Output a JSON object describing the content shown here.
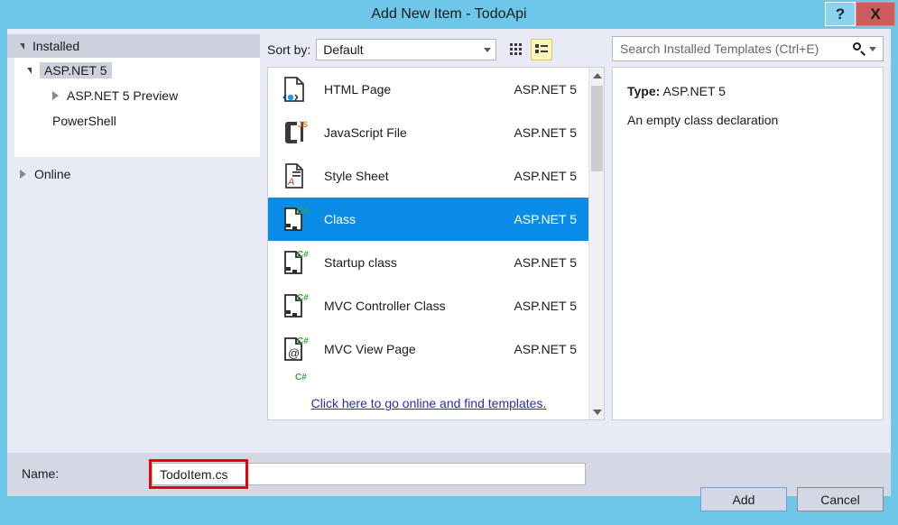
{
  "window": {
    "title": "Add New Item - TodoApi",
    "help_label": "?",
    "close_label": "X"
  },
  "sidebar": {
    "installed_label": "Installed",
    "tree": [
      {
        "label": "ASP.NET 5",
        "selected": true,
        "expanded": true
      },
      {
        "label": "ASP.NET 5 Preview",
        "selected": false,
        "expanded": false
      },
      {
        "label": "PowerShell",
        "selected": false,
        "expanded": null
      }
    ],
    "online_label": "Online"
  },
  "toolbar": {
    "sort_by_label": "Sort by:",
    "sort_value": "Default",
    "grid_view_title": "Medium Icons",
    "list_view_title": "List"
  },
  "search": {
    "placeholder": "Search Installed Templates (Ctrl+E)",
    "value": ""
  },
  "templates": {
    "items": [
      {
        "name": "HTML Page",
        "tag": "ASP.NET 5",
        "icon": "html-page-icon",
        "selected": false
      },
      {
        "name": "JavaScript File",
        "tag": "ASP.NET 5",
        "icon": "javascript-file-icon",
        "selected": false
      },
      {
        "name": "Style Sheet",
        "tag": "ASP.NET 5",
        "icon": "style-sheet-icon",
        "selected": false
      },
      {
        "name": "Class",
        "tag": "ASP.NET 5",
        "icon": "csharp-class-icon",
        "selected": true
      },
      {
        "name": "Startup class",
        "tag": "ASP.NET 5",
        "icon": "csharp-class-icon",
        "selected": false
      },
      {
        "name": "MVC Controller Class",
        "tag": "ASP.NET 5",
        "icon": "csharp-class-icon",
        "selected": false
      },
      {
        "name": "MVC View Page",
        "tag": "ASP.NET 5",
        "icon": "mvc-view-page-icon",
        "selected": false
      }
    ],
    "online_link_label": "Click here to go online and find templates."
  },
  "details": {
    "type_label": "Type:",
    "type_value": "ASP.NET 5",
    "description": "An empty class declaration"
  },
  "name_field": {
    "label": "Name:",
    "value": "TodoItem.cs"
  },
  "footer": {
    "add_label": "Add",
    "cancel_label": "Cancel"
  },
  "colors": {
    "title_bar": "#6ec6e8",
    "close_button": "#cd5c5c",
    "selection": "#0c8ce9",
    "dialog_bg": "#e8ebf5",
    "bottom_bar": "#d4d8e4",
    "link": "#2b2bbd",
    "annotation_red": "#e8030a",
    "active_view_btn": "#fdf4bf"
  }
}
